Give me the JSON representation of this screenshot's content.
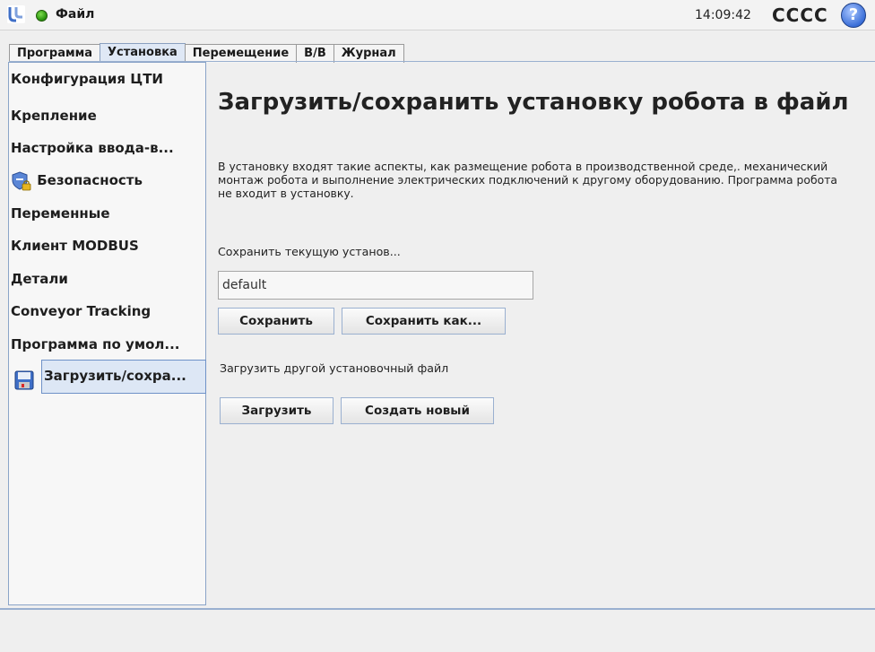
{
  "topbar": {
    "logo_icon": "ur-logo-icon",
    "status_color": "#2f9a12",
    "file_menu": "Файл",
    "clock": "14:09:42",
    "robot_name": "CCCC",
    "help": "?"
  },
  "tabs": [
    {
      "label": "Программа"
    },
    {
      "label": "Установка"
    },
    {
      "label": "Перемещение"
    },
    {
      "label": "В/В"
    },
    {
      "label": "Журнал"
    }
  ],
  "active_tab": "Установка",
  "sidebar": {
    "items": [
      {
        "label": "Конфигурация ЦТИ"
      },
      {
        "label": "Крепление"
      },
      {
        "label": "Настройка ввода-в..."
      },
      {
        "label": "Безопасность",
        "icon": "shield-lock-icon"
      },
      {
        "label": "Переменные"
      },
      {
        "label": "Клиент MODBUS"
      },
      {
        "label": "Детали"
      },
      {
        "label": "Conveyor Tracking"
      },
      {
        "label": "Программа по умол..."
      },
      {
        "label": "Загрузить/сохра...",
        "icon": "floppy-disk-icon",
        "selected": true
      }
    ]
  },
  "main": {
    "title": "Загрузить/сохранить установку робота в файл",
    "description": "В установку входят такие аспекты, как размещение робота в производственной среде,. механический монтаж робота и выполнение электрических подключений к другому оборудованию. Программа робота не входит в установку.",
    "save_label": "Сохранить текущую установ...",
    "filename_value": "default",
    "save_button": "Сохранить",
    "save_as_button": "Сохранить как...",
    "load_label": "Загрузить другой установочный файл",
    "load_button": "Загрузить",
    "new_button": "Создать новый"
  },
  "colors": {
    "accent": "#9ab0d0",
    "selection": "#dde7f5"
  }
}
